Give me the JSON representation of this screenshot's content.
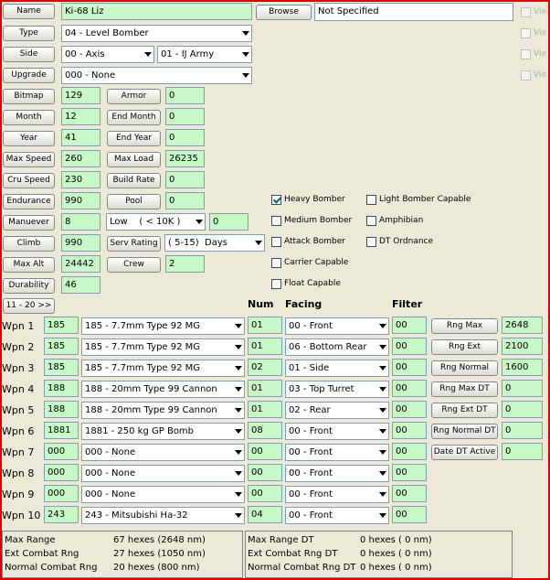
{
  "header": {
    "name_label": "Name",
    "name_value": "Ki-68 Liz",
    "browse_label": "Browse",
    "file_value": "Not Specified",
    "type_label": "Type",
    "type_value": "04 - Level Bomber",
    "side_label": "Side",
    "side_value": "00 - Axis",
    "army_value": "01 - IJ Army",
    "upgrade_label": "Upgrade",
    "upgrade_value": "000 - None",
    "view_labels": [
      "Vie",
      "Vie",
      "Vie",
      "Vie"
    ]
  },
  "stats_left": [
    {
      "label": "Bitmap",
      "value": "129"
    },
    {
      "label": "Month",
      "value": "12"
    },
    {
      "label": "Year",
      "value": "41"
    },
    {
      "label": "Max Speed",
      "value": "260"
    },
    {
      "label": "Cru Speed",
      "value": "230"
    },
    {
      "label": "Endurance",
      "value": "990"
    },
    {
      "label": "Manuever",
      "value": "8"
    },
    {
      "label": "Climb",
      "value": "990"
    },
    {
      "label": "Max Alt",
      "value": "24442"
    },
    {
      "label": "Durability",
      "value": "46"
    }
  ],
  "stats_mid": [
    {
      "label": "Armor",
      "value": "0"
    },
    {
      "label": "End Month",
      "value": "0"
    },
    {
      "label": "End Year",
      "value": "0"
    },
    {
      "label": "Max Load",
      "value": "26235"
    },
    {
      "label": "Build Rate",
      "value": "0"
    },
    {
      "label": "Pool",
      "value": "0"
    }
  ],
  "maneuver_select": "Low    ( < 10K )",
  "maneuver_extra": "0",
  "serv_rating_label": "Serv Rating",
  "serv_rating_value": "( 5-15)  Days",
  "crew_label": "Crew",
  "crew_value": "2",
  "checkboxes_col1": [
    {
      "label": "Heavy Bomber",
      "checked": true
    },
    {
      "label": "Medium Bomber",
      "checked": false
    },
    {
      "label": "Attack Bomber",
      "checked": false
    },
    {
      "label": "Carrier Capable",
      "checked": false
    },
    {
      "label": "Float Capable",
      "checked": false
    }
  ],
  "checkboxes_col2": [
    {
      "label": "Light Bomber Capable",
      "checked": false
    },
    {
      "label": "Amphibian",
      "checked": false
    },
    {
      "label": "DT Ordnance",
      "checked": false
    }
  ],
  "range_button": "11 - 20 >>",
  "weapon_headers": {
    "num": "Num",
    "facing": "Facing",
    "filter": "Filter"
  },
  "weapons": [
    {
      "label": "Wpn 1",
      "id": "185",
      "name": "185 - 7.7mm Type 92 MG",
      "num": "01",
      "facing": "00 - Front",
      "filter": "00"
    },
    {
      "label": "Wpn 2",
      "id": "185",
      "name": "185 - 7.7mm Type 92 MG",
      "num": "01",
      "facing": "06 - Bottom Rear",
      "filter": "00"
    },
    {
      "label": "Wpn 3",
      "id": "185",
      "name": "185 - 7.7mm Type 92 MG",
      "num": "02",
      "facing": "01 - Side",
      "filter": "00"
    },
    {
      "label": "Wpn 4",
      "id": "188",
      "name": "188 - 20mm Type 99 Cannon",
      "num": "01",
      "facing": "03 - Top Turret",
      "filter": "00"
    },
    {
      "label": "Wpn 5",
      "id": "188",
      "name": "188 - 20mm Type 99 Cannon",
      "num": "01",
      "facing": "02 - Rear",
      "filter": "00"
    },
    {
      "label": "Wpn 6",
      "id": "1881",
      "name": "1881 - 250 kg GP Bomb",
      "num": "08",
      "facing": "00 - Front",
      "filter": "00"
    },
    {
      "label": "Wpn 7",
      "id": "000",
      "name": "000 - None",
      "num": "00",
      "facing": "00 - Front",
      "filter": "00"
    },
    {
      "label": "Wpn 8",
      "id": "000",
      "name": "000 - None",
      "num": "00",
      "facing": "00 - Front",
      "filter": "00"
    },
    {
      "label": "Wpn 9",
      "id": "000",
      "name": "000 - None",
      "num": "00",
      "facing": "00 - Front",
      "filter": "00"
    },
    {
      "label": "Wpn 10",
      "id": "243",
      "name": "243 - Mitsubishi Ha-32",
      "num": "04",
      "facing": "00 - Front",
      "filter": "00"
    }
  ],
  "ranges": [
    {
      "label": "Rng Max",
      "value": "2648"
    },
    {
      "label": "Rng Ext",
      "value": "2100"
    },
    {
      "label": "Rng Normal",
      "value": "1600"
    },
    {
      "label": "Rng Max DT",
      "value": "0"
    },
    {
      "label": "Rng Ext DT",
      "value": "0"
    },
    {
      "label": "Rng Normal DT",
      "value": "0"
    },
    {
      "label": "Date DT Active",
      "value": "0"
    }
  ],
  "summary_left": [
    {
      "label": "Max Range",
      "value": "67 hexes (2648 nm)"
    },
    {
      "label": "Ext Combat Rng",
      "value": "27 hexes (1050 nm)"
    },
    {
      "label": "Normal Combat Rng",
      "value": "20 hexes (800 nm)"
    }
  ],
  "summary_right": [
    {
      "label": "Max Range DT",
      "value": "0 hexes ( 0 nm)"
    },
    {
      "label": "Ext Combat Rng DT",
      "value": "0 hexes ( 0 nm)"
    },
    {
      "label": "Normal Combat Rng DT",
      "value": "0 hexes ( 0 nm)"
    }
  ]
}
